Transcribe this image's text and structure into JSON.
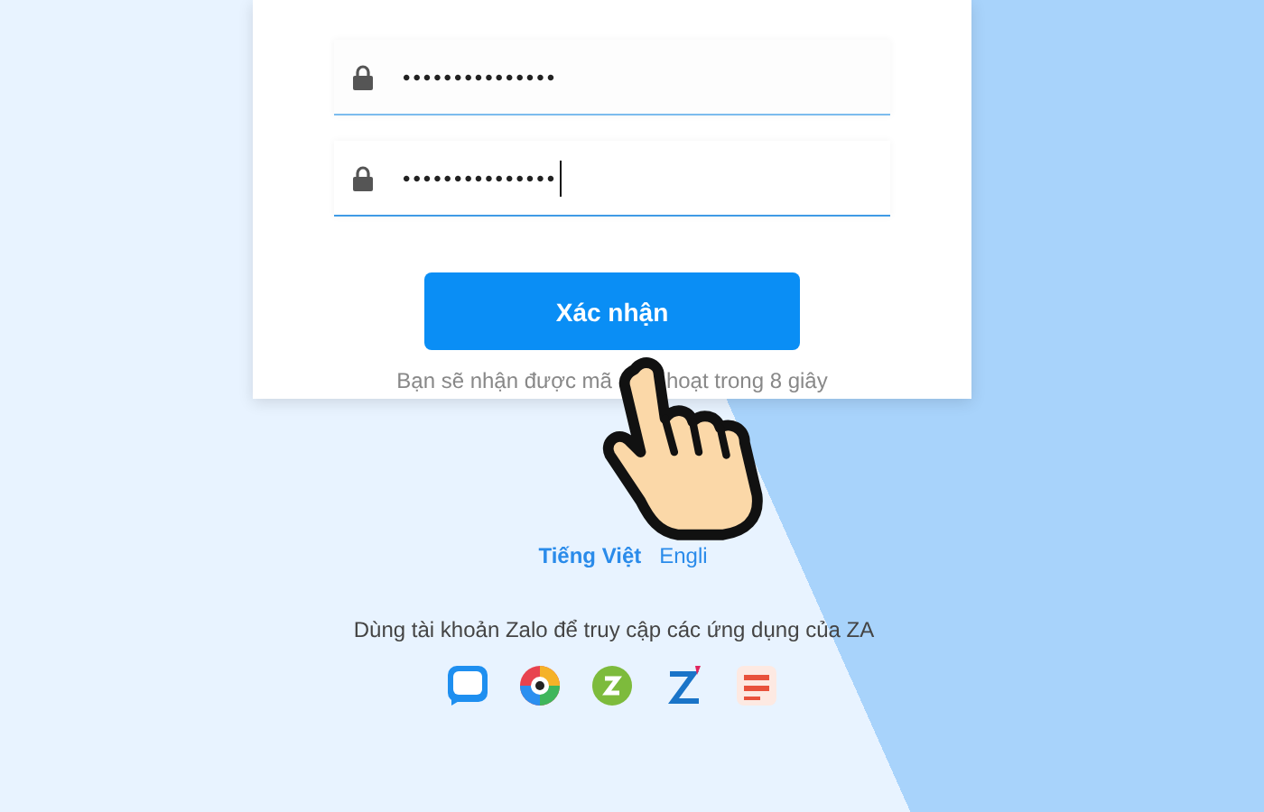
{
  "form": {
    "fields": [
      {
        "value": "•••••••••••••••",
        "focused": false
      },
      {
        "value": "•••••••••••••••",
        "focused": true
      }
    ],
    "submit": "Xác nhận",
    "note_parts": [
      "Bạn sẽ nhận được mã",
      "hoạt trong 8 giây"
    ]
  },
  "languages": [
    {
      "label": "Tiếng Việt",
      "selected": true
    },
    {
      "label": "Engli",
      "selected": false
    }
  ],
  "apps_caption": "Dùng tài khoản Zalo để truy cập các ứng dụng của ZA",
  "apps": [
    {
      "kind": "chat"
    },
    {
      "kind": "camera"
    },
    {
      "kind": "zing"
    },
    {
      "kind": "zmp3"
    },
    {
      "kind": "news"
    }
  ]
}
